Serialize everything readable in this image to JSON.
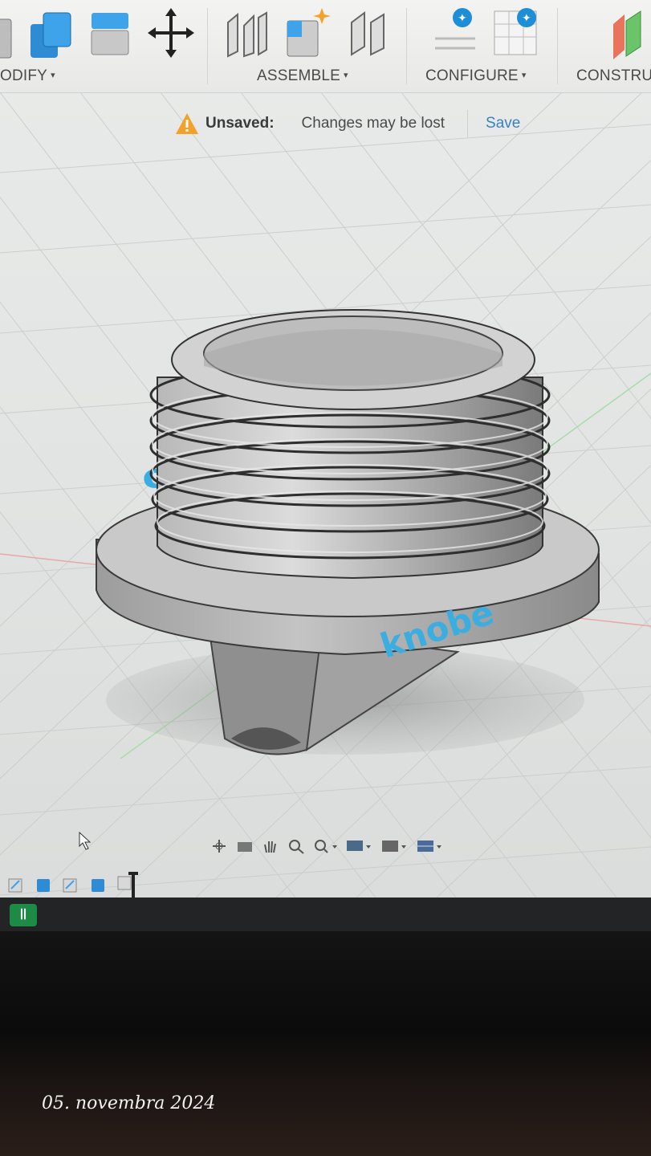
{
  "toolbar": {
    "groups": [
      {
        "label": "ODIFY",
        "caret": "▾"
      },
      {
        "label": "ASSEMBLE",
        "caret": "▾"
      },
      {
        "label": "CONFIGURE",
        "caret": "▾"
      },
      {
        "label": "CONSTRU",
        "caret": ""
      }
    ]
  },
  "banner": {
    "label": "Unsaved:",
    "message": "Changes may be lost",
    "save": "Save"
  },
  "model": {
    "engraving_front": "oIT",
    "engraving_side": "knobe"
  },
  "taskbar": {
    "app_glyph": "ꟾꟾ"
  },
  "photo": {
    "date_stamp": "05. novembra 2024"
  },
  "colors": {
    "accent": "#3b7fc4",
    "warning": "#f4a12a",
    "model_gray": "#9a9a9a",
    "engrave_blue": "#3aaee0"
  }
}
